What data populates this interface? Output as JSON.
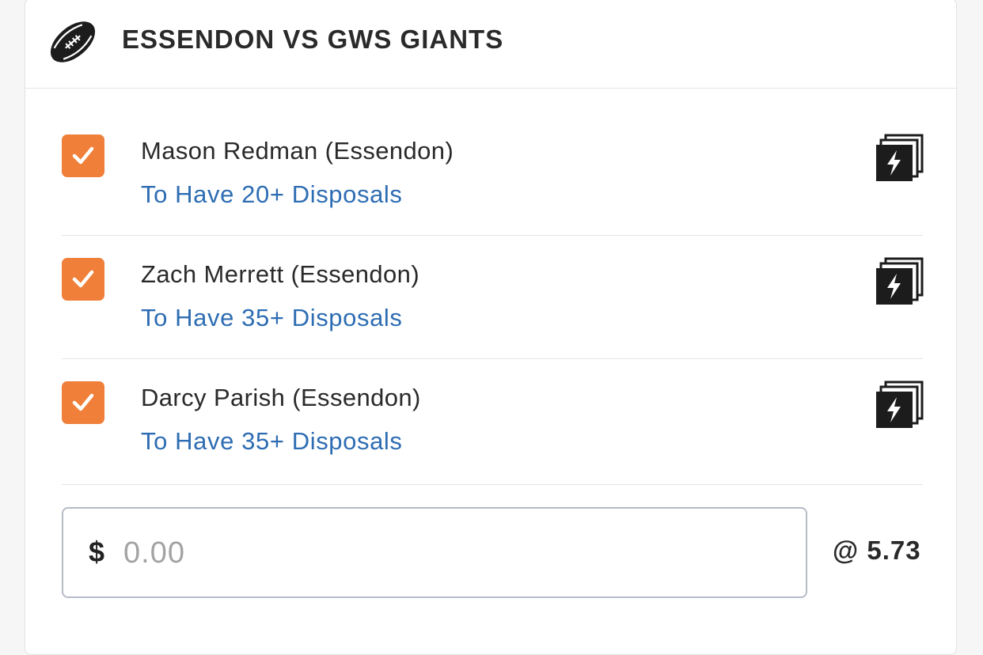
{
  "header": {
    "icon": "football-icon",
    "title": "ESSENDON VS GWS GIANTS"
  },
  "legs": [
    {
      "checked": true,
      "player": "Mason Redman (Essendon)",
      "market": "To Have 20+ Disposals",
      "icon": "same-game-multi-icon"
    },
    {
      "checked": true,
      "player": "Zach Merrett (Essendon)",
      "market": "To Have 35+ Disposals",
      "icon": "same-game-multi-icon"
    },
    {
      "checked": true,
      "player": "Darcy Parish (Essendon)",
      "market": "To Have 35+ Disposals",
      "icon": "same-game-multi-icon"
    }
  ],
  "stake": {
    "currency": "$",
    "value": "",
    "placeholder": "0.00"
  },
  "odds": "@ 5.73",
  "colors": {
    "checkbox": "#f07f3a",
    "market_link": "#2e6db3",
    "text": "#2a2a2a"
  }
}
